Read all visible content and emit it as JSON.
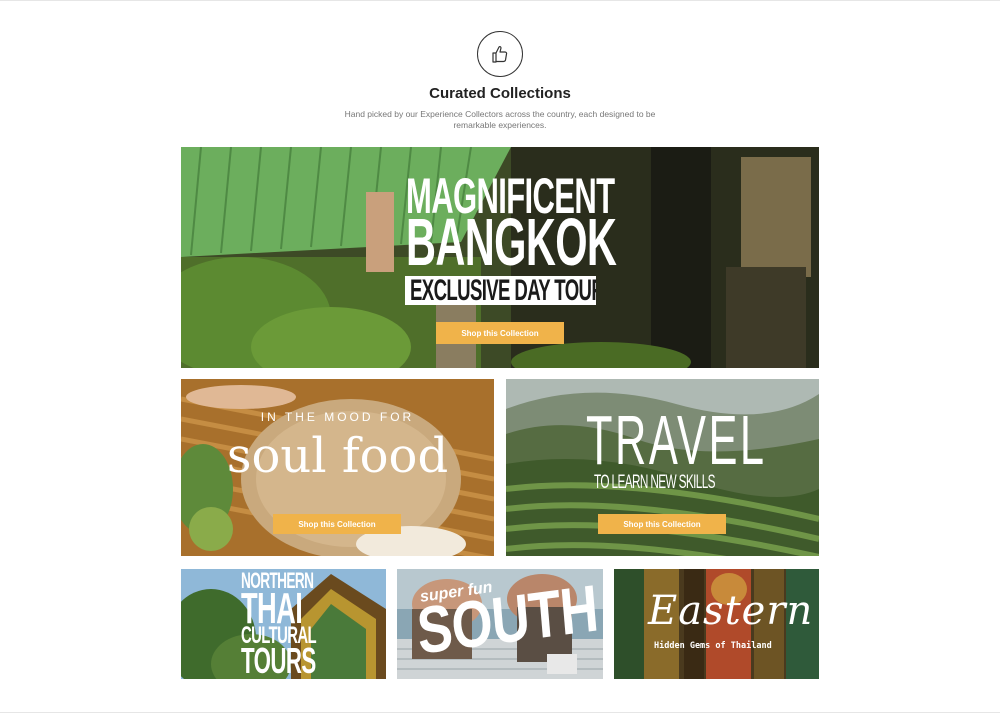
{
  "header": {
    "title": "Curated Collections",
    "subtitle": "Hand picked by our Experience Collectors across the country, each designed to be remarkable experiences."
  },
  "collections": {
    "bangkok": {
      "line1": "MAGNIFICENT",
      "line2": "BANGKOK",
      "line3": "EXCLUSIVE DAY TOURS",
      "button": "Shop this Collection"
    },
    "soulfood": {
      "kicker": "IN THE MOOD FOR",
      "headline": "soul food",
      "button": "Shop this Collection"
    },
    "travel": {
      "headline": "TRAVEL",
      "tagline": "TO LEARN NEW SKILLS",
      "button": "Shop this Collection"
    },
    "northern": {
      "line1": "NORTHERN",
      "line2": "THAI",
      "line3": "CULTURAL",
      "line4": "TOURS"
    },
    "south": {
      "kicker": "super fun",
      "headline": "SOUTH"
    },
    "eastern": {
      "headline": "Eastern",
      "tagline": "Hidden Gems of Thailand"
    }
  },
  "colors": {
    "button": "#f0b34a",
    "text_dark": "#222222"
  }
}
